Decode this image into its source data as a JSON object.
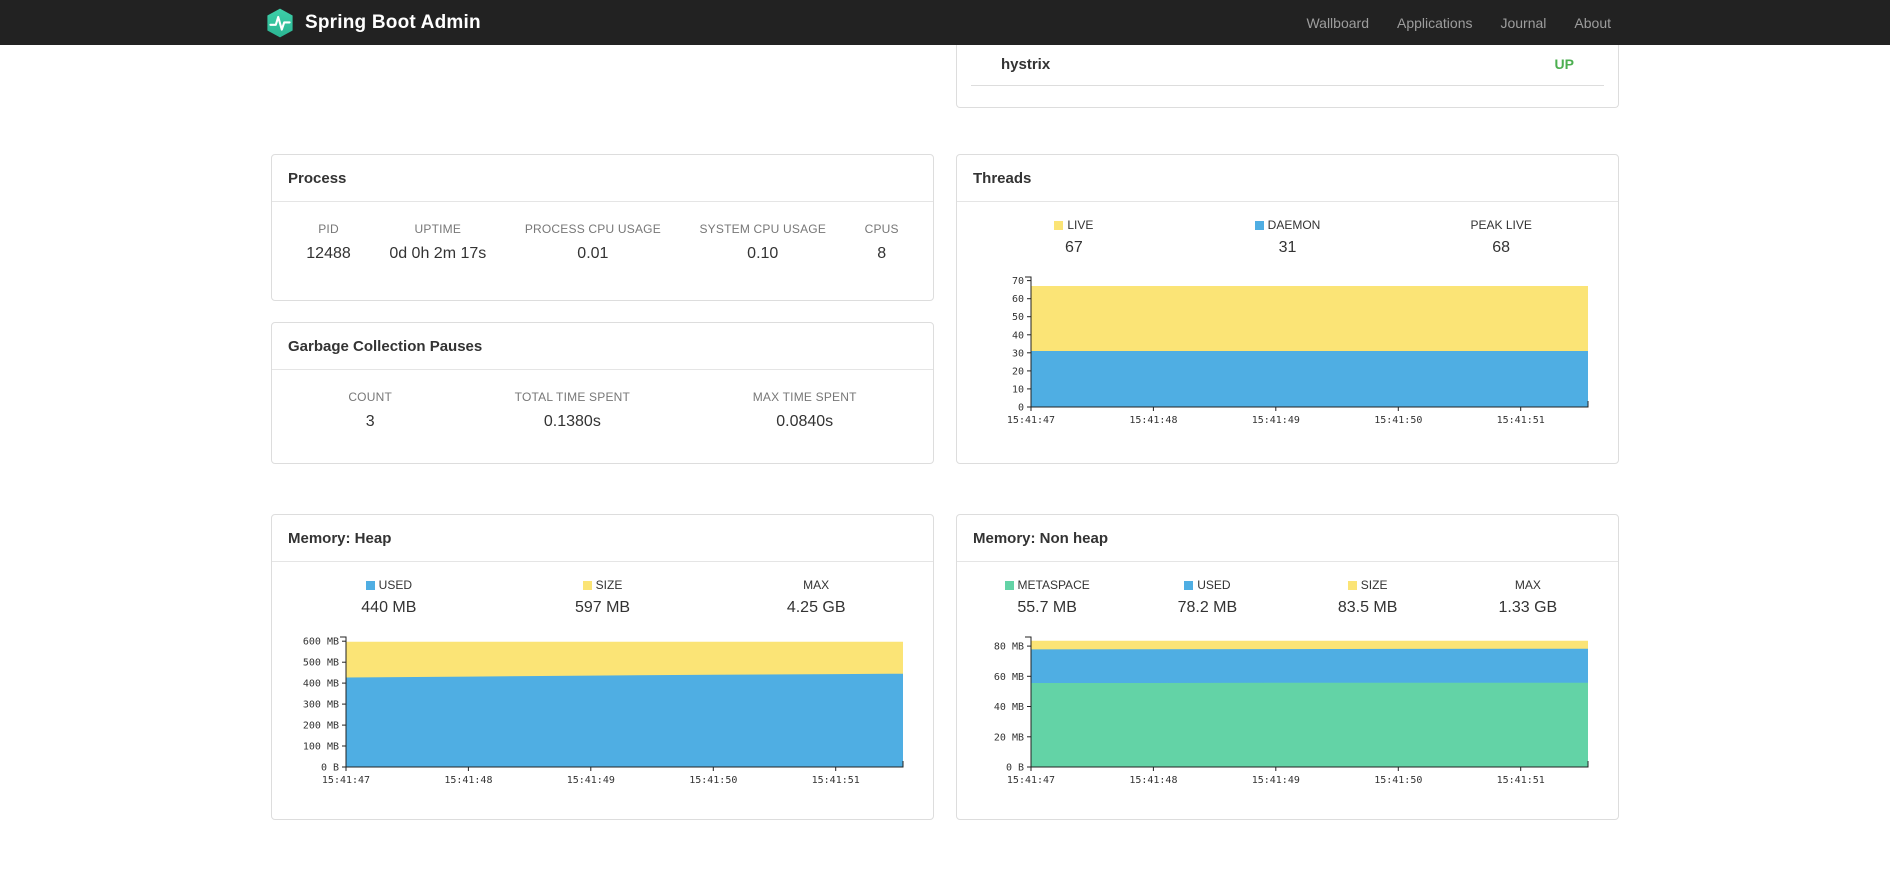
{
  "navbar": {
    "brand": "Spring Boot Admin",
    "links": [
      "Wallboard",
      "Applications",
      "Journal",
      "About"
    ]
  },
  "colors": {
    "navbar_bg": "#222222",
    "brand_teal": "#36C6A3",
    "status_up": "#4CAF50",
    "series_yellow": "#FBE476",
    "series_blue": "#4FAEE3",
    "series_green": "#63D3A6"
  },
  "health": {
    "row_label": "hystrix",
    "row_status": "UP"
  },
  "process": {
    "title": "Process",
    "stats": [
      {
        "label": "PID",
        "value": "12488"
      },
      {
        "label": "UPTIME",
        "value": "0d 0h 2m 17s"
      },
      {
        "label": "PROCESS CPU USAGE",
        "value": "0.01"
      },
      {
        "label": "SYSTEM CPU USAGE",
        "value": "0.10"
      },
      {
        "label": "CPUS",
        "value": "8"
      }
    ]
  },
  "gc": {
    "title": "Garbage Collection Pauses",
    "stats": [
      {
        "label": "COUNT",
        "value": "3"
      },
      {
        "label": "TOTAL TIME SPENT",
        "value": "0.1380s"
      },
      {
        "label": "MAX TIME SPENT",
        "value": "0.0840s"
      }
    ]
  },
  "threads": {
    "title": "Threads",
    "legend": [
      {
        "label": "LIVE",
        "value": "67",
        "color": "#FBE476"
      },
      {
        "label": "DAEMON",
        "value": "31",
        "color": "#4FAEE3"
      },
      {
        "label": "PEAK LIVE",
        "value": "68"
      }
    ]
  },
  "heap": {
    "title": "Memory: Heap",
    "legend": [
      {
        "label": "USED",
        "value": "440 MB",
        "color": "#4FAEE3"
      },
      {
        "label": "SIZE",
        "value": "597 MB",
        "color": "#FBE476"
      },
      {
        "label": "MAX",
        "value": "4.25 GB"
      }
    ]
  },
  "nonheap": {
    "title": "Memory: Non heap",
    "legend": [
      {
        "label": "METASPACE",
        "value": "55.7 MB",
        "color": "#63D3A6"
      },
      {
        "label": "USED",
        "value": "78.2 MB",
        "color": "#4FAEE3"
      },
      {
        "label": "SIZE",
        "value": "83.5 MB",
        "color": "#FBE476"
      },
      {
        "label": "MAX",
        "value": "1.33 GB"
      }
    ]
  },
  "chart_data": [
    {
      "name": "threads-chart",
      "type": "area",
      "title": "Threads",
      "x": [
        0,
        1,
        2,
        3,
        4,
        4.55
      ],
      "xmax": 4.55,
      "ymax": 72,
      "xticks": [
        {
          "v": 0,
          "label": "15:41:47"
        },
        {
          "v": 1,
          "label": "15:41:48"
        },
        {
          "v": 2,
          "label": "15:41:49"
        },
        {
          "v": 3,
          "label": "15:41:50"
        },
        {
          "v": 4,
          "label": "15:41:51"
        }
      ],
      "yticks": [
        {
          "v": 0,
          "label": "0"
        },
        {
          "v": 10,
          "label": "10"
        },
        {
          "v": 20,
          "label": "20"
        },
        {
          "v": 30,
          "label": "30"
        },
        {
          "v": 40,
          "label": "40"
        },
        {
          "v": 50,
          "label": "50"
        },
        {
          "v": 60,
          "label": "60"
        },
        {
          "v": 70,
          "label": "70"
        }
      ],
      "series": [
        {
          "name": "LIVE",
          "color": "#FBE476",
          "values": [
            67,
            67,
            67,
            67,
            67,
            67
          ]
        },
        {
          "name": "DAEMON",
          "color": "#4FAEE3",
          "values": [
            31,
            31,
            31,
            31,
            31,
            31
          ]
        }
      ],
      "legend_position": "top",
      "grid": false
    },
    {
      "name": "heap-memory-chart",
      "type": "area",
      "title": "Memory: Heap",
      "x": [
        0,
        1,
        2,
        3,
        4,
        4.55
      ],
      "xmax": 4.55,
      "ymax": 620,
      "xticks": [
        {
          "v": 0,
          "label": "15:41:47"
        },
        {
          "v": 1,
          "label": "15:41:48"
        },
        {
          "v": 2,
          "label": "15:41:49"
        },
        {
          "v": 3,
          "label": "15:41:50"
        },
        {
          "v": 4,
          "label": "15:41:51"
        }
      ],
      "yticks": [
        {
          "v": 0,
          "label": "0 B"
        },
        {
          "v": 100,
          "label": "100 MB"
        },
        {
          "v": 200,
          "label": "200 MB"
        },
        {
          "v": 300,
          "label": "300 MB"
        },
        {
          "v": 400,
          "label": "400 MB"
        },
        {
          "v": 500,
          "label": "500 MB"
        },
        {
          "v": 600,
          "label": "600 MB"
        }
      ],
      "series": [
        {
          "name": "SIZE",
          "color": "#FBE476",
          "values": [
            597,
            597,
            597,
            597,
            597,
            597
          ]
        },
        {
          "name": "USED",
          "color": "#4FAEE3",
          "values": [
            427,
            431,
            436,
            440,
            443,
            445
          ]
        }
      ],
      "legend_position": "top",
      "grid": false
    },
    {
      "name": "non-heap-memory-chart",
      "type": "area",
      "title": "Memory: Non heap",
      "x": [
        0,
        1,
        2,
        3,
        4,
        4.55
      ],
      "xmax": 4.55,
      "ymax": 86,
      "xticks": [
        {
          "v": 0,
          "label": "15:41:47"
        },
        {
          "v": 1,
          "label": "15:41:48"
        },
        {
          "v": 2,
          "label": "15:41:49"
        },
        {
          "v": 3,
          "label": "15:41:50"
        },
        {
          "v": 4,
          "label": "15:41:51"
        }
      ],
      "yticks": [
        {
          "v": 0,
          "label": "0 B"
        },
        {
          "v": 20,
          "label": "20 MB"
        },
        {
          "v": 40,
          "label": "40 MB"
        },
        {
          "v": 60,
          "label": "60 MB"
        },
        {
          "v": 80,
          "label": "80 MB"
        }
      ],
      "series": [
        {
          "name": "SIZE",
          "color": "#FBE476",
          "values": [
            83.5,
            83.5,
            83.5,
            83.5,
            83.5,
            83.5
          ]
        },
        {
          "name": "USED",
          "color": "#4FAEE3",
          "values": [
            77.8,
            77.9,
            78.0,
            78.1,
            78.2,
            78.2
          ]
        },
        {
          "name": "METASPACE",
          "color": "#63D3A6",
          "values": [
            55.6,
            55.6,
            55.7,
            55.7,
            55.7,
            55.7
          ]
        }
      ],
      "legend_position": "top",
      "grid": false
    }
  ]
}
